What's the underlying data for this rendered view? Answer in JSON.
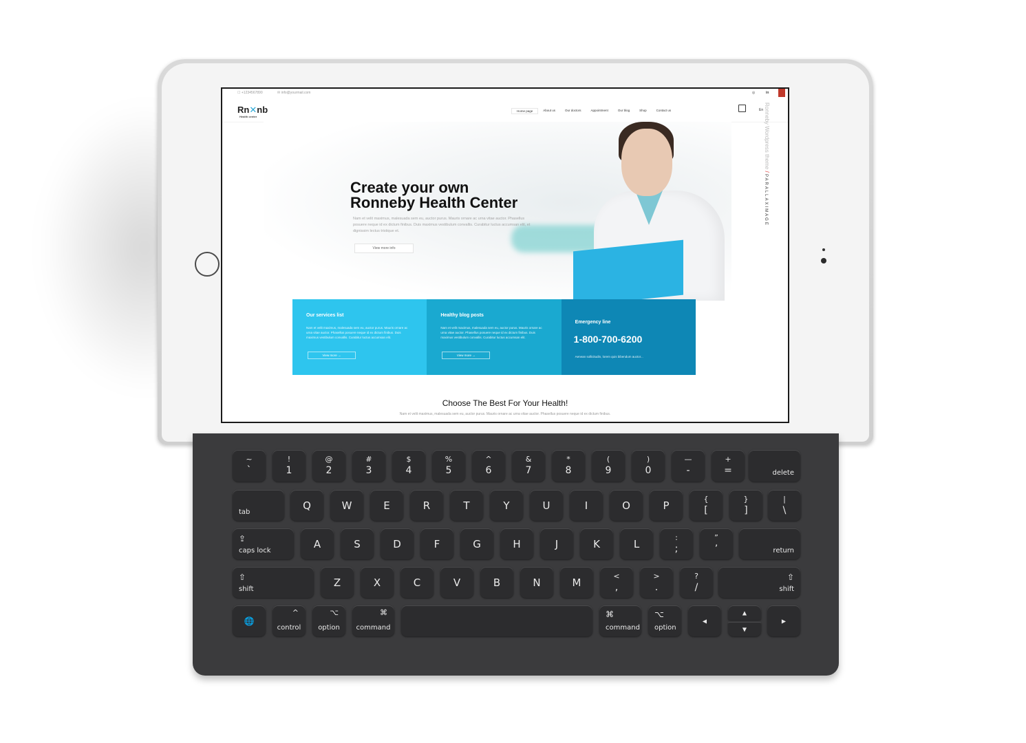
{
  "site": {
    "topbar": {
      "phone": "+1234567890",
      "email": "info@yourmail.com",
      "social": [
        "◎",
        "in",
        "v"
      ]
    },
    "logo": {
      "left": "Rn",
      "right": "nb",
      "sub": "Health center"
    },
    "nav": [
      "Home page",
      "About us",
      "Our doctors",
      "Appointment",
      "Our blog",
      "Shop",
      "Contact us"
    ],
    "lang": "En",
    "side_text": {
      "theme": "Ronneby Wordpress theme",
      "sep": "/",
      "name": "PARALLAXIMAGE"
    },
    "hero": {
      "title_line1": "Create your own",
      "title_line2": "Ronneby Health Center",
      "text": "Nam et velit maximus, malesuada sem eu, auctor purus. Mauris ornare ac urna vitae auctor. Phasellus posuere neque id ex dictum finibus. Duis maximus vestibulum convallis. Curabitur luctus accumsan elit, et dignissim lectus tristique et.",
      "button": "View more info"
    },
    "boxes": [
      {
        "title": "Our services list",
        "text": "Nam et velit maximus, malesuada sem eu, auctor purus. Mauris ornare ac urna vitae auctor. Phasellus posuere neque id ex dictum finibus. Duis maximus vestibulum convallis. Curabitur luctus accumsan elit.",
        "button": "View more"
      },
      {
        "title": "Healthy blog posts",
        "text": "Nam et velit maximus, malesuada sem eu, auctor purus. Mauris ornare ac urna vitae auctor. Phasellus posuere neque id ex dictum finibus. Duis maximus vestibulum convallis. Curabitur luctus accumsan elit.",
        "button": "View more"
      },
      {
        "title": "Emergency line",
        "phone": "1-800-700-6200",
        "text": "Aenean sollicitudin, lorem quis bibendum auctor..."
      }
    ],
    "section": {
      "title": "Choose The Best For Your Health!",
      "text": "Nam et velit maximus, malesuada sem eu, auctor purus. Mauris ornare ac urna vitae auctor. Phasellus posuere neque id ex dictum finibus."
    }
  },
  "keyboard": {
    "row1": [
      {
        "top": "~",
        "bottom": "`"
      },
      {
        "top": "!",
        "bottom": "1"
      },
      {
        "top": "@",
        "bottom": "2"
      },
      {
        "top": "#",
        "bottom": "3"
      },
      {
        "top": "$",
        "bottom": "4"
      },
      {
        "top": "%",
        "bottom": "5"
      },
      {
        "top": "^",
        "bottom": "6"
      },
      {
        "top": "&",
        "bottom": "7"
      },
      {
        "top": "*",
        "bottom": "8"
      },
      {
        "top": "(",
        "bottom": "9"
      },
      {
        "top": ")",
        "bottom": "0"
      },
      {
        "top": "—",
        "bottom": "-"
      },
      {
        "top": "+",
        "bottom": "="
      }
    ],
    "delete": "delete",
    "tab": "tab",
    "row2": [
      "Q",
      "W",
      "E",
      "R",
      "T",
      "Y",
      "U",
      "I",
      "O",
      "P"
    ],
    "row2_sym": [
      {
        "top": "{",
        "bottom": "["
      },
      {
        "top": "}",
        "bottom": "]"
      },
      {
        "top": "|",
        "bottom": "\\"
      }
    ],
    "caps": "caps lock",
    "row3": [
      "A",
      "S",
      "D",
      "F",
      "G",
      "H",
      "J",
      "K",
      "L"
    ],
    "row3_sym": [
      {
        "top": ":",
        "bottom": ";"
      },
      {
        "top": "”",
        "bottom": "’"
      }
    ],
    "return": "return",
    "shift": "shift",
    "row4": [
      "Z",
      "X",
      "C",
      "V",
      "B",
      "N",
      "M"
    ],
    "row4_sym": [
      {
        "top": "<",
        "bottom": ","
      },
      {
        "top": ">",
        "bottom": "."
      },
      {
        "top": "?",
        "bottom": "/"
      }
    ],
    "control": "control",
    "option": "option",
    "command": "command",
    "icons": {
      "globe": "🌐",
      "control": "^",
      "option": "⌥",
      "command": "⌘",
      "shift": "⇧",
      "caps": "⇪",
      "left": "◀",
      "right": "▶",
      "up": "▲",
      "down": "▼"
    }
  },
  "colors": {
    "accent1": "#2ec5ee",
    "accent2": "#1aa9d0",
    "accent3": "#0e87b5"
  }
}
